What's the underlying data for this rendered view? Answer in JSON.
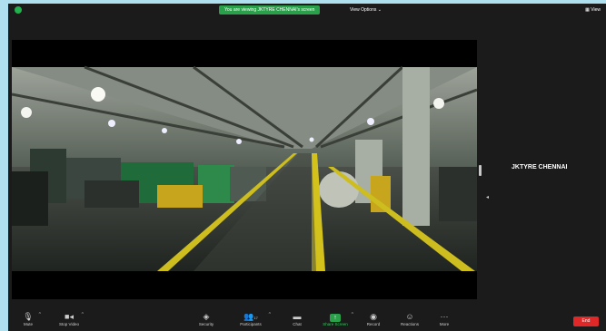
{
  "top_bar": {
    "shield_icon": "shield-icon",
    "share_banner": "You are viewing JKTYRE CHENNAI's screen",
    "view_options": "View Options ⌄",
    "view_button": "▦ View"
  },
  "shared_screen": {
    "scene": "factory-floor-video"
  },
  "side_panel": {
    "participant_name": "JKTYRE CHENNAI"
  },
  "toolbar": {
    "mute": {
      "icon": "microphone-icon",
      "label": "Mute"
    },
    "stop_video": {
      "icon": "video-camera-icon",
      "label": "Stop Video"
    },
    "security": {
      "icon": "shield-icon",
      "label": "Security"
    },
    "participants": {
      "icon": "participants-icon",
      "label": "Participants",
      "count": "17"
    },
    "chat": {
      "icon": "chat-icon",
      "label": "Chat"
    },
    "share_screen": {
      "icon": "share-screen-icon",
      "label": "Share Screen"
    },
    "record": {
      "icon": "record-icon",
      "label": "Record"
    },
    "reactions": {
      "icon": "reactions-icon",
      "label": "Reactions"
    },
    "more": {
      "icon": "more-icon",
      "label": "More"
    },
    "end": {
      "label": "End"
    }
  },
  "colors": {
    "window_bg": "#1b1b1b",
    "accent_green": "#2aa04a",
    "end_red": "#e02828",
    "outer_frame": "#aee0f0"
  }
}
